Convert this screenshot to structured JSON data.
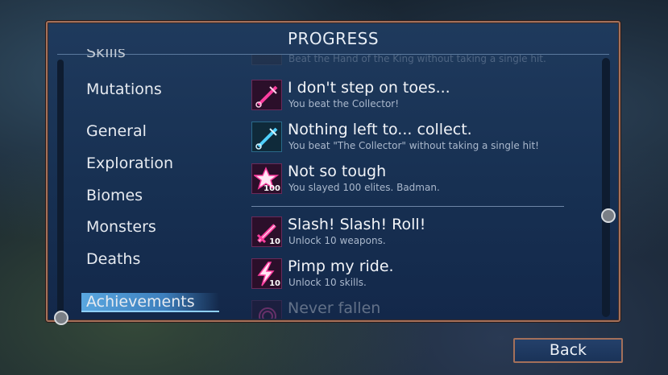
{
  "panel": {
    "title": "PROGRESS"
  },
  "menu": {
    "items": [
      "Skills",
      "Mutations",
      "General",
      "Exploration",
      "Biomes",
      "Monsters",
      "Deaths",
      "Achievements"
    ],
    "selected": "Achievements"
  },
  "achievements": [
    {
      "name": "",
      "desc": "Beat the Hand of the King without taking a single hit.",
      "badge": "",
      "icon": "blade-icon"
    },
    {
      "name": "I don't step on toes...",
      "desc": "You beat the Collector!",
      "badge": "",
      "icon": "syringe-icon"
    },
    {
      "name": "Nothing left to... collect.",
      "desc": "You beat \"The Collector\" without taking a single hit!",
      "badge": "",
      "icon": "syringe-icon"
    },
    {
      "name": "Not so tough",
      "desc": "You slayed 100 elites. Badman.",
      "badge": "100",
      "icon": "star-icon"
    },
    {
      "name": "Slash! Slash! Roll!",
      "desc": "Unlock 10 weapons.",
      "badge": "10",
      "icon": "sword-icon"
    },
    {
      "name": "Pimp my ride.",
      "desc": "Unlock 10 skills.",
      "badge": "10",
      "icon": "lightning-icon"
    },
    {
      "name": "Never fallen",
      "desc": "",
      "badge": "",
      "icon": "fingerprint-icon"
    }
  ],
  "buttons": {
    "back": "Back"
  },
  "colors": {
    "accent": "#5aa7e0",
    "frame": "#a4705a",
    "icon_pink": "#ff3fa0"
  }
}
